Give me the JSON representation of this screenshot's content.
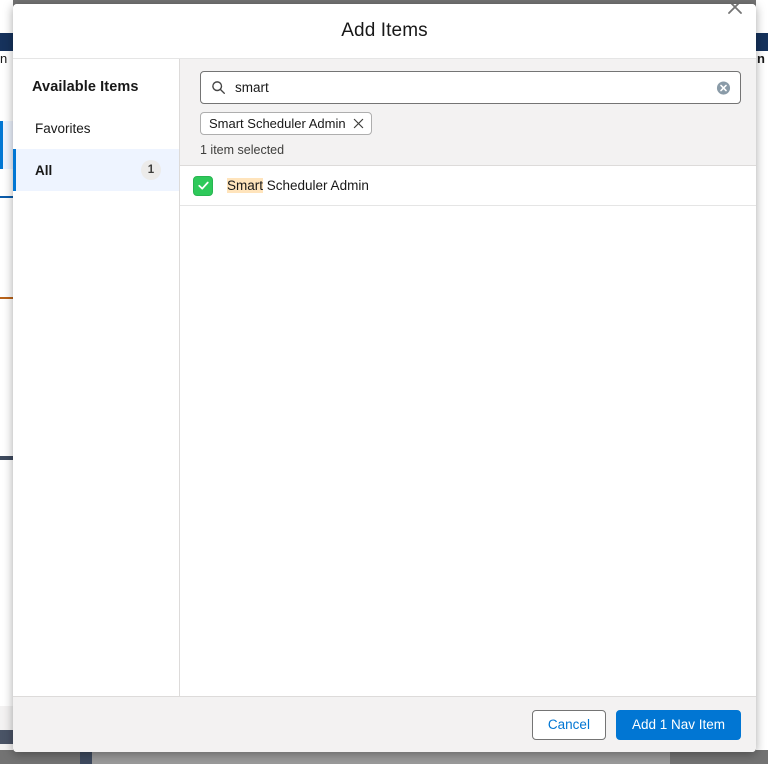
{
  "background": {
    "left_letter": "n",
    "right_letter": "n"
  },
  "dialog": {
    "title": "Add Items",
    "close_icon": "close-icon"
  },
  "sidebar": {
    "heading": "Available Items",
    "items": [
      {
        "label": "Favorites",
        "count": "",
        "active": false
      },
      {
        "label": "All",
        "count": "1",
        "active": true
      }
    ]
  },
  "search": {
    "icon": "search-icon",
    "value": "smart",
    "placeholder": "Search",
    "clear_icon": "clear-icon"
  },
  "pills": [
    {
      "label": "Smart Scheduler Admin",
      "remove_icon": "close-icon"
    }
  ],
  "selection": {
    "status": "1 item selected"
  },
  "list": {
    "rows": [
      {
        "checked": true,
        "check_icon": "check-icon",
        "highlight": "Smart",
        "rest": " Scheduler Admin"
      }
    ]
  },
  "footer": {
    "cancel_label": "Cancel",
    "submit_label": "Add 1 Nav Item"
  },
  "colors": {
    "accent": "#0176d3",
    "selected_row_bg": "#eef4ff",
    "checkbox_green": "#2ec95a",
    "highlight_bg": "#ffe4bc",
    "footer_bg": "#f3f2f2",
    "backdrop": "#737373"
  }
}
